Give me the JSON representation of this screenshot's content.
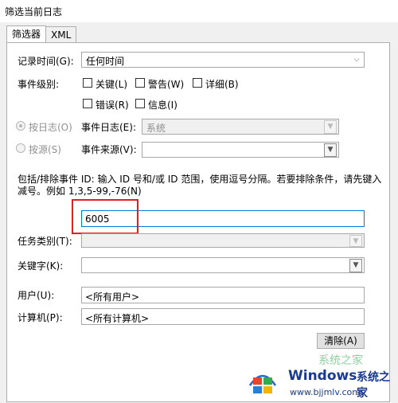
{
  "window": {
    "title": "筛选当前日志"
  },
  "tabs": [
    {
      "label": "筛选器"
    },
    {
      "label": "XML"
    }
  ],
  "logged": {
    "label": "记录时间(G):",
    "value": "任何时间"
  },
  "event_level": {
    "label": "事件级别:",
    "options": [
      {
        "label": "关键(L)",
        "checked": false
      },
      {
        "label": "警告(W)",
        "checked": false
      },
      {
        "label": "详细(B)",
        "checked": false
      },
      {
        "label": "错误(R)",
        "checked": false
      },
      {
        "label": "信息(I)",
        "checked": false
      }
    ]
  },
  "by_log": {
    "radio_label": "按日志(O)",
    "label": "事件日志(E):",
    "value": "系统"
  },
  "by_source": {
    "radio_label": "按源(S)",
    "label": "事件来源(V):",
    "value": ""
  },
  "event_ids": {
    "help": "包括/排除事件 ID: 输入 ID 号和/或 ID 范围，使用逗号分隔。若要排除条件，请先键入减号。例如 1,3,5-99,-76(N)",
    "value": "6005"
  },
  "task_category": {
    "label": "任务类别(T):",
    "value": ""
  },
  "keywords": {
    "label": "关键字(K):",
    "value": ""
  },
  "user": {
    "label": "用户(U):",
    "value": "<所有用户>"
  },
  "computer": {
    "label": "计算机(P):",
    "value": "<所有计算机>"
  },
  "clear_button": {
    "label": "清除(A)"
  },
  "watermark": {
    "brand": "Windows",
    "brand_cn": "系统之家",
    "url": "www.bjjmlv.com",
    "top_text": "系统之家"
  },
  "colors": {
    "highlight": "#e02020",
    "focus_border": "#0078d7",
    "watermark": "#1a3a8f"
  }
}
